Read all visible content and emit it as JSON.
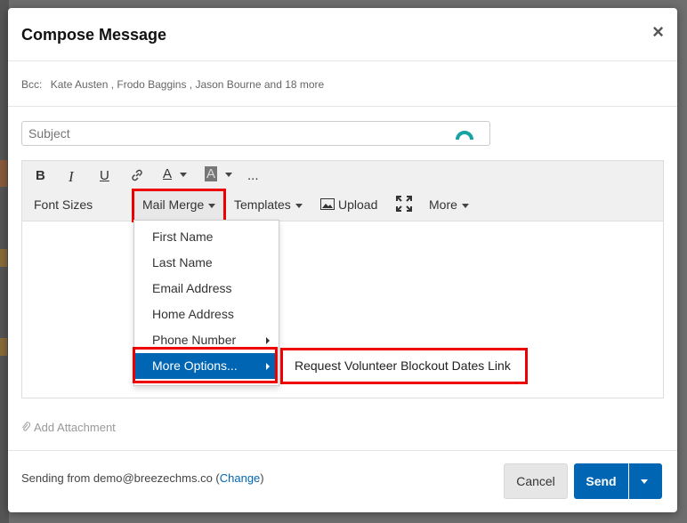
{
  "modal": {
    "title": "Compose Message",
    "close_glyph": "×"
  },
  "bcc": {
    "label": "Bcc:",
    "recipients": "Kate Austen , Frodo Baggins , Jason Bourne and 18 more"
  },
  "subject": {
    "placeholder": "Subject",
    "value": ""
  },
  "toolbar": {
    "bold": "B",
    "italic": "I",
    "underline": "U",
    "font_color": "A",
    "bg_color": "A",
    "more_dots": "...",
    "font_sizes": "Font Sizes",
    "mail_merge": "Mail Merge",
    "templates": "Templates",
    "upload": "Upload",
    "more": "More"
  },
  "mail_merge_menu": {
    "items": [
      {
        "label": "First Name"
      },
      {
        "label": "Last Name"
      },
      {
        "label": "Email Address"
      },
      {
        "label": "Home Address"
      },
      {
        "label": "Phone Number"
      },
      {
        "label": "More Options..."
      }
    ]
  },
  "submenu": {
    "item": "Request Volunteer Blockout Dates Link"
  },
  "attachment": {
    "label": "Add Attachment"
  },
  "footer": {
    "sending_prefix": "Sending from demo@breezechms.co (",
    "change_link": "Change",
    "sending_suffix": ")",
    "cancel": "Cancel",
    "send": "Send"
  },
  "colors": {
    "primary": "#0066b3",
    "highlight_border": "#e00000",
    "toolbar_bg": "#f0f0f0"
  },
  "icons": [
    "close-icon",
    "link-icon",
    "font-color-icon",
    "background-color-icon",
    "image-icon",
    "fullscreen-icon",
    "paperclip-icon",
    "caret-down-icon",
    "caret-right-icon",
    "grammarly-icon"
  ]
}
